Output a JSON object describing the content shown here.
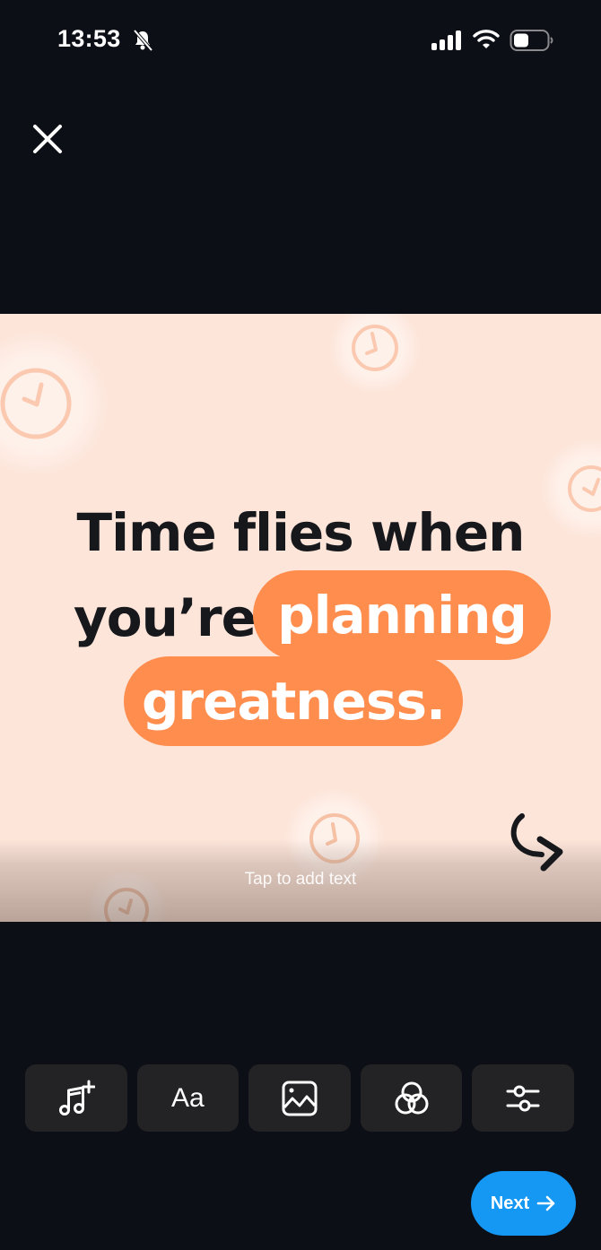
{
  "status_bar": {
    "time": "13:53",
    "icons": [
      "bell-slash-icon",
      "signal-icon",
      "wifi-icon",
      "battery-icon"
    ]
  },
  "header": {
    "close_icon": "close-icon"
  },
  "canvas": {
    "headline_line1": "Time flies when",
    "headline_line2_plain": "you’re",
    "highlight_1": "planning",
    "highlight_2": "greatness.",
    "tap_hint": "Tap to add text",
    "colors": {
      "background": "#fde5da",
      "highlight": "#ff8d4e",
      "text": "#17181c"
    }
  },
  "toolbar": {
    "items": [
      {
        "name": "add-music",
        "icon": "music-add-icon",
        "label": ""
      },
      {
        "name": "text",
        "icon": "text-icon",
        "label": "Aa"
      },
      {
        "name": "image",
        "icon": "image-icon",
        "label": ""
      },
      {
        "name": "filters",
        "icon": "filters-icon",
        "label": ""
      },
      {
        "name": "adjust",
        "icon": "sliders-icon",
        "label": ""
      }
    ]
  },
  "footer": {
    "next_label": "Next",
    "next_color": "#1597f4"
  }
}
